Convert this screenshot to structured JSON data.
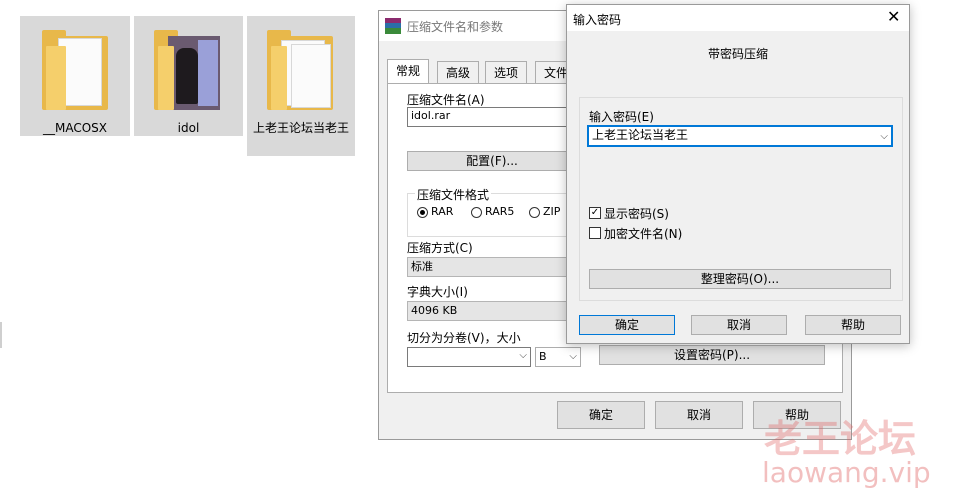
{
  "desktop": {
    "files": [
      {
        "name": "__MACOSX"
      },
      {
        "name": "idol"
      },
      {
        "name": "上老王论坛当老王"
      }
    ]
  },
  "archive_dialog": {
    "title": "压缩文件名和参数",
    "tabs": [
      "常规",
      "高级",
      "选项",
      "文件"
    ],
    "archive_name_label": "压缩文件名(A)",
    "archive_name_value": "idol.rar",
    "profiles_button": "配置(F)...",
    "format_group_label": "压缩文件格式",
    "formats": [
      {
        "label": "RAR",
        "selected": true
      },
      {
        "label": "RAR5",
        "selected": false
      },
      {
        "label": "ZIP",
        "selected": false
      }
    ],
    "method_label": "压缩方式(C)",
    "method_value": "标准",
    "dict_label": "字典大小(I)",
    "dict_value": "4096 KB",
    "split_label": "切分为分卷(V)，大小",
    "split_value": "",
    "split_unit": "B",
    "set_password_button": "设置密码(P)...",
    "ok_button": "确定",
    "cancel_button": "取消",
    "help_button": "帮助"
  },
  "password_dialog": {
    "title": "输入密码",
    "heading": "带密码压缩",
    "enter_password_label": "输入密码(E)",
    "password_value": "上老王论坛当老王",
    "show_password": {
      "label": "显示密码(S)",
      "checked": true
    },
    "encrypt_names": {
      "label": "加密文件名(N)",
      "checked": false
    },
    "organize_button": "整理密码(O)...",
    "ok_button": "确定",
    "cancel_button": "取消",
    "help_button": "帮助"
  },
  "watermark": {
    "title": "老王论坛",
    "url": "laowang.vip"
  },
  "colors": {
    "selection": "#d9d9d9",
    "dialog_bg": "#f0f0f0",
    "focus_border": "#0078d7",
    "watermark": "#e06060"
  }
}
